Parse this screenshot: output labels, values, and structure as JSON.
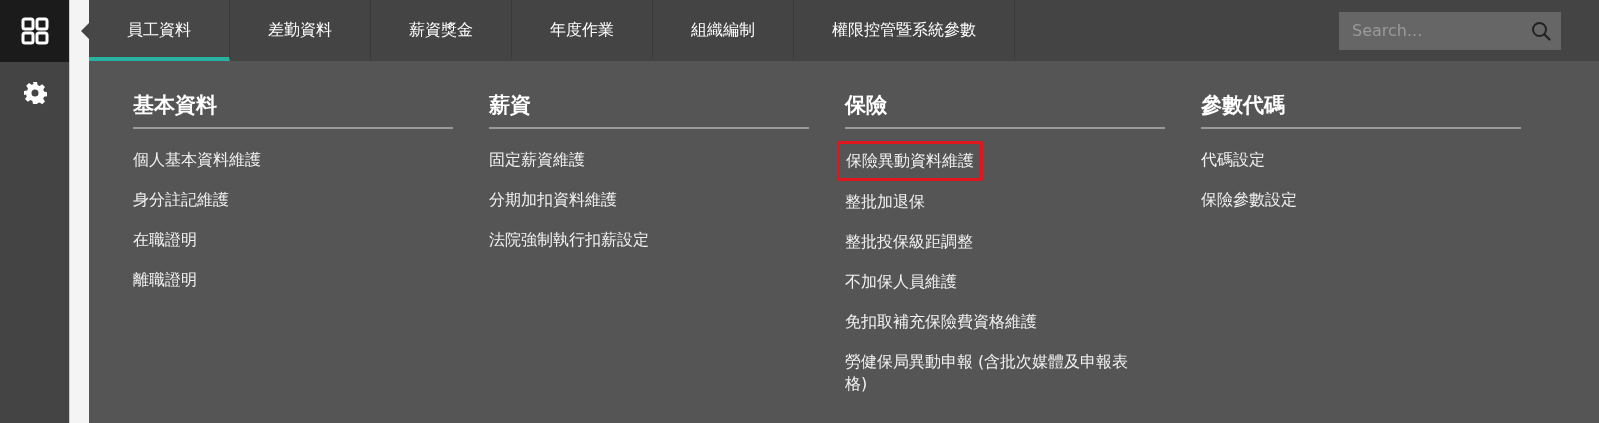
{
  "tabs": [
    {
      "label": "員工資料",
      "selected": true
    },
    {
      "label": "差勤資料",
      "selected": false
    },
    {
      "label": "薪資獎金",
      "selected": false
    },
    {
      "label": "年度作業",
      "selected": false
    },
    {
      "label": "組織編制",
      "selected": false
    },
    {
      "label": "權限控管暨系統參數",
      "selected": false
    }
  ],
  "search": {
    "placeholder": "Search..."
  },
  "menu_columns": [
    {
      "heading": "基本資料",
      "items": [
        {
          "label": "個人基本資料維護",
          "highlighted": false
        },
        {
          "label": "身分註記維護",
          "highlighted": false
        },
        {
          "label": "在職證明",
          "highlighted": false
        },
        {
          "label": "離職證明",
          "highlighted": false
        }
      ]
    },
    {
      "heading": "薪資",
      "items": [
        {
          "label": "固定薪資維護",
          "highlighted": false
        },
        {
          "label": "分期加扣資料維護",
          "highlighted": false
        },
        {
          "label": "法院強制執行扣薪設定",
          "highlighted": false
        }
      ]
    },
    {
      "heading": "保險",
      "items": [
        {
          "label": "保險異動資料維護",
          "highlighted": true
        },
        {
          "label": "整批加退保",
          "highlighted": false
        },
        {
          "label": "整批投保級距調整",
          "highlighted": false
        },
        {
          "label": "不加保人員維護",
          "highlighted": false
        },
        {
          "label": "免扣取補充保險費資格維護",
          "highlighted": false
        },
        {
          "label": "勞健保局異動申報 (含批次媒體及申報表格)",
          "highlighted": false
        }
      ]
    },
    {
      "heading": "參數代碼",
      "items": [
        {
          "label": "代碼設定",
          "highlighted": false
        },
        {
          "label": "保險參數設定",
          "highlighted": false
        }
      ]
    }
  ]
}
